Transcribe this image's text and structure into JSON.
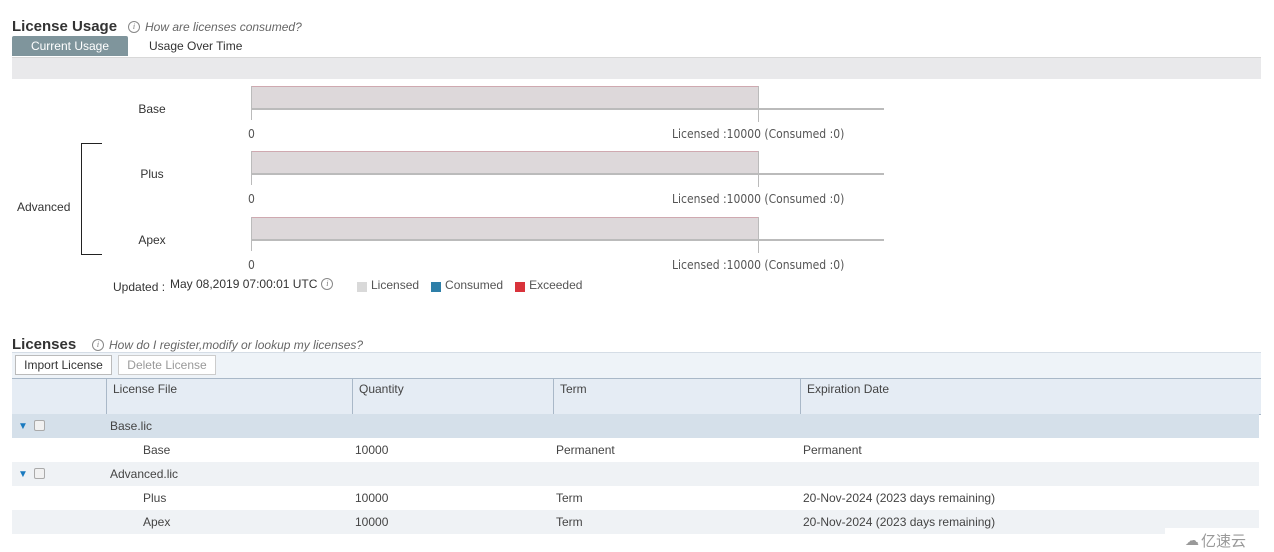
{
  "usage": {
    "title": "License Usage",
    "help_text": "How are licenses consumed?",
    "tabs": [
      {
        "label": "Current Usage",
        "active": true
      },
      {
        "label": "Usage Over Time",
        "active": false
      }
    ],
    "group_label": "Advanced",
    "rows": [
      {
        "name": "Base",
        "min_label": "0",
        "licensed": 10000,
        "consumed": 0,
        "summary": "Licensed :10000 (Consumed :0)"
      },
      {
        "name": "Plus",
        "min_label": "0",
        "licensed": 10000,
        "consumed": 0,
        "summary": "Licensed :10000 (Consumed :0)"
      },
      {
        "name": "Apex",
        "min_label": "0",
        "licensed": 10000,
        "consumed": 0,
        "summary": "Licensed :10000 (Consumed :0)"
      }
    ],
    "updated_label": "Updated :",
    "updated_value": "May 08,2019 07:00:01 UTC",
    "legend": [
      {
        "label": "Licensed",
        "color": "#d9d9d9"
      },
      {
        "label": "Consumed",
        "color": "#2e7fa8"
      },
      {
        "label": "Exceeded",
        "color": "#d9333b"
      }
    ]
  },
  "licenses": {
    "title": "Licenses",
    "help_text": "How do I register,modify or lookup my licenses?",
    "import_label": "Import License",
    "delete_label": "Delete License",
    "columns": [
      "License File",
      "Quantity",
      "Term",
      "Expiration Date"
    ],
    "groups": [
      {
        "file": "Base.lic",
        "items": [
          {
            "name": "Base",
            "quantity": "10000",
            "term": "Permanent",
            "expiration": "Permanent"
          }
        ]
      },
      {
        "file": "Advanced.lic",
        "items": [
          {
            "name": "Plus",
            "quantity": "10000",
            "term": "Term",
            "expiration": "20-Nov-2024 (2023 days remaining)"
          },
          {
            "name": "Apex",
            "quantity": "10000",
            "term": "Term",
            "expiration": "20-Nov-2024 (2023 days remaining)"
          }
        ]
      }
    ]
  },
  "watermark": "亿速云"
}
